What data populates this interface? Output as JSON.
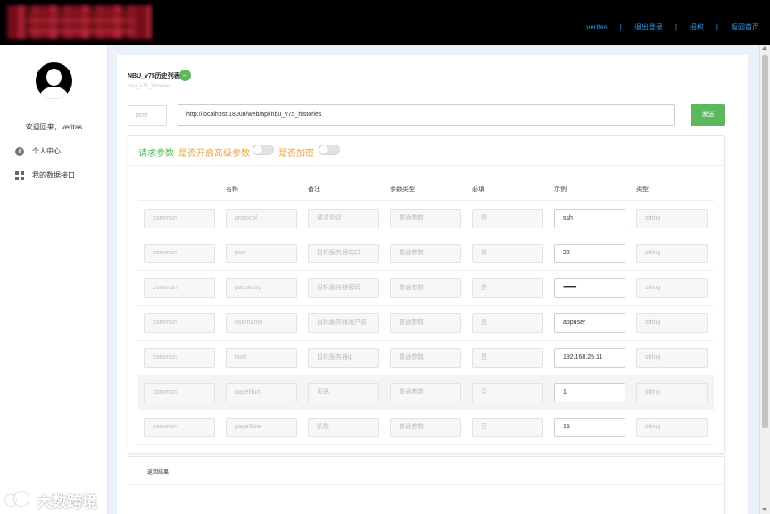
{
  "topbar": {
    "nav": [
      "veritas",
      "退出登录",
      "授权",
      "返回首页"
    ]
  },
  "sidebar": {
    "welcome": "欢迎回来，veritas",
    "items": [
      {
        "label": "个人中心",
        "icon": "info-icon"
      },
      {
        "label": "我的数据接口",
        "icon": "grid-icon"
      }
    ]
  },
  "page": {
    "title": "NBU_v75历史列表",
    "subtitle": "nbu_v75_histories",
    "method_placeholder": "post",
    "url": "http://localhost:18008/web/api/nbu_v75_histories",
    "send_label": "发送"
  },
  "params": {
    "title": "请求参数",
    "advanced_label": "是否开启高级参数",
    "encrypt_label": "是否加密",
    "advanced_on": false,
    "encrypt_on": false,
    "columns": [
      "名称",
      "备注",
      "参数类型",
      "必填",
      "示例",
      "类型"
    ],
    "rows": [
      {
        "group": "common",
        "name": "protocol",
        "note": "请求协议",
        "ptype": "普通参数",
        "required": "是",
        "example": "ssh",
        "type": "string"
      },
      {
        "group": "common",
        "name": "port",
        "note": "目标服务器端口",
        "ptype": "普通参数",
        "required": "是",
        "example": "22",
        "type": "string"
      },
      {
        "group": "common",
        "name": "password",
        "note": "目标服务器密码",
        "ptype": "普通参数",
        "required": "是",
        "example": "••••••••••",
        "type": "string"
      },
      {
        "group": "common",
        "name": "username",
        "note": "目标服务器用户名",
        "ptype": "普通参数",
        "required": "是",
        "example": "appuser",
        "type": "string"
      },
      {
        "group": "common",
        "name": "host",
        "note": "目标服务器ip",
        "ptype": "普通参数",
        "required": "是",
        "example": "192.168.25.11",
        "type": "string"
      },
      {
        "group": "common",
        "name": "pageNum",
        "note": "页码",
        "ptype": "普通参数",
        "required": "否",
        "example": "1",
        "type": "string"
      },
      {
        "group": "common",
        "name": "pageSize",
        "note": "条数",
        "ptype": "普通参数",
        "required": "否",
        "example": "15",
        "type": "string"
      }
    ]
  },
  "result": {
    "title": "返回结果"
  },
  "watermark": {
    "text": "大数跨境"
  },
  "colors": {
    "accent_green": "#5cb85c",
    "accent_orange": "#e8a53a",
    "link_blue": "#2d9be8"
  }
}
